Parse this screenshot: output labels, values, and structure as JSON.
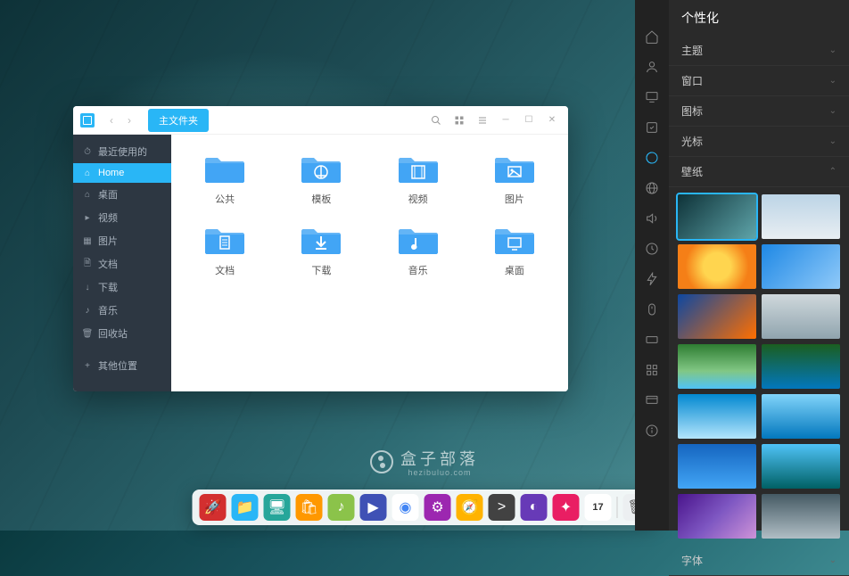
{
  "fileManager": {
    "tab": "主文件夹",
    "sidebar": [
      {
        "icon": "⏱",
        "label": "最近使用的"
      },
      {
        "icon": "⌂",
        "label": "Home"
      },
      {
        "icon": "⌂",
        "label": "桌面"
      },
      {
        "icon": "▸",
        "label": "视频"
      },
      {
        "icon": "▦",
        "label": "图片"
      },
      {
        "icon": "🗎",
        "label": "文档"
      },
      {
        "icon": "↓",
        "label": "下载"
      },
      {
        "icon": "♪",
        "label": "音乐"
      },
      {
        "icon": "🗑",
        "label": "回收站"
      },
      {
        "icon": "+",
        "label": "其他位置"
      }
    ],
    "sidebarActive": 1,
    "folders": [
      {
        "label": "公共",
        "glyph": ""
      },
      {
        "label": "模板",
        "glyph": "compass"
      },
      {
        "label": "视频",
        "glyph": "film"
      },
      {
        "label": "图片",
        "glyph": "image"
      },
      {
        "label": "文档",
        "glyph": "doc"
      },
      {
        "label": "下载",
        "glyph": "download"
      },
      {
        "label": "音乐",
        "glyph": "music"
      },
      {
        "label": "桌面",
        "glyph": "desktop"
      }
    ]
  },
  "watermark": {
    "title": "盒子部落",
    "sub": "hezibuluo.com"
  },
  "settings": {
    "title": "个性化",
    "sections": [
      {
        "label": "主题",
        "open": false
      },
      {
        "label": "窗口",
        "open": false
      },
      {
        "label": "图标",
        "open": false
      },
      {
        "label": "光标",
        "open": false
      },
      {
        "label": "壁纸",
        "open": true
      },
      {
        "label": "字体",
        "open": false
      }
    ],
    "wallpapers": [
      {
        "bg": "linear-gradient(135deg,#0e3238,#5fa5aa)",
        "sel": true
      },
      {
        "bg": "linear-gradient(#bcd4e6,#e8eef2)"
      },
      {
        "bg": "radial-gradient(circle at 50% 50%,#ffd54f 30%,#f57f17 70%)"
      },
      {
        "bg": "linear-gradient(135deg,#1e88e5,#90caf9)"
      },
      {
        "bg": "linear-gradient(135deg,#0d47a1,#ff6f00)"
      },
      {
        "bg": "linear-gradient(#cfd8dc,#90a4ae)"
      },
      {
        "bg": "linear-gradient(#2e7d32,#81c784 60%,#4fc3f7)"
      },
      {
        "bg": "linear-gradient(#1b5e20,#0277bd)"
      },
      {
        "bg": "linear-gradient(#0288d1,#b3e5fc)"
      },
      {
        "bg": "linear-gradient(#81d4fa,#0277bd)"
      },
      {
        "bg": "linear-gradient(#1565c0,#42a5f5)"
      },
      {
        "bg": "linear-gradient(#4fc3f7,#006064)"
      },
      {
        "bg": "linear-gradient(135deg,#4a148c,#7e57c2,#ce93d8)"
      },
      {
        "bg": "linear-gradient(#455a64,#b0bec5)"
      }
    ]
  },
  "dock": [
    {
      "name": "launcher",
      "bg": "#d32f2f",
      "glyph": "🚀"
    },
    {
      "name": "files",
      "bg": "#29b6f6",
      "glyph": "📁"
    },
    {
      "name": "display",
      "bg": "#26a69a",
      "glyph": "🖥"
    },
    {
      "name": "store",
      "bg": "#ff9800",
      "glyph": "🛍"
    },
    {
      "name": "music",
      "bg": "#8bc34a",
      "glyph": "♪"
    },
    {
      "name": "video",
      "bg": "#3f51b5",
      "glyph": "▶"
    },
    {
      "name": "chrome",
      "bg": "#fff",
      "glyph": "◉"
    },
    {
      "name": "settings",
      "bg": "#9c27b0",
      "glyph": "⚙"
    },
    {
      "name": "safari",
      "bg": "#ffb300",
      "glyph": "🧭"
    },
    {
      "name": "terminal",
      "bg": "#424242",
      "glyph": ">"
    },
    {
      "name": "app1",
      "bg": "#673ab7",
      "glyph": "◐"
    },
    {
      "name": "app2",
      "bg": "#e91e63",
      "glyph": "✦"
    },
    {
      "name": "calendar",
      "bg": "#fff",
      "glyph": "17"
    },
    {
      "name": "trash",
      "bg": "#eceff1",
      "glyph": "🗑"
    }
  ]
}
